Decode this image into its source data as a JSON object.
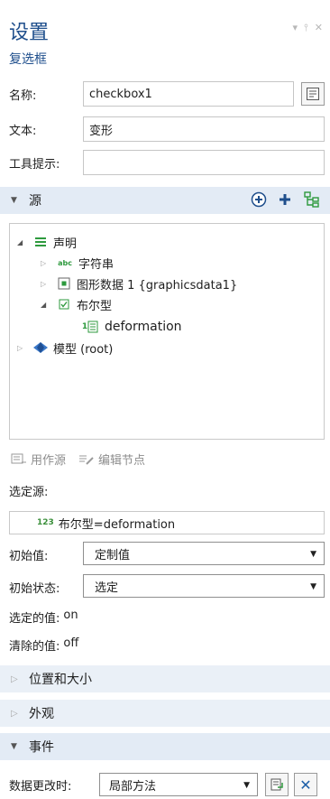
{
  "panel": {
    "title": "设置",
    "subtitle": "复选框"
  },
  "fields": {
    "name_label": "名称:",
    "name_value": "checkbox1",
    "text_label": "文本:",
    "text_value": "变形",
    "tooltip_label": "工具提示:",
    "tooltip_value": ""
  },
  "source_section": {
    "title": "源"
  },
  "tree": {
    "declarations": "声明",
    "string_badge": "abc",
    "string": "字符串",
    "graphicsdata": "图形数据 1 {graphicsdata1}",
    "boolean": "布尔型",
    "deformation_badge": "1",
    "deformation": "deformation",
    "model": "模型 (root)"
  },
  "toolbar": {
    "use_as_source": "用作源",
    "edit_node": "编辑节点"
  },
  "selected_source": {
    "label": "选定源:",
    "badge": "123",
    "value": "布尔型=deformation"
  },
  "initial_value": {
    "label": "初始值:",
    "selected": "定制值"
  },
  "initial_state": {
    "label": "初始状态:",
    "selected": "选定"
  },
  "selected_value": {
    "label": "选定的值:",
    "value": "on"
  },
  "cleared_value": {
    "label": "清除的值:",
    "value": "off"
  },
  "sections": {
    "position_size": "位置和大小",
    "appearance": "外观",
    "events": "事件"
  },
  "events": {
    "on_data_change_label": "数据更改时:",
    "method_selected": "局部方法"
  },
  "colors": {
    "accent": "#1e4e8c",
    "section_bg": "#e3ebf5",
    "green": "#2e9a3e"
  }
}
